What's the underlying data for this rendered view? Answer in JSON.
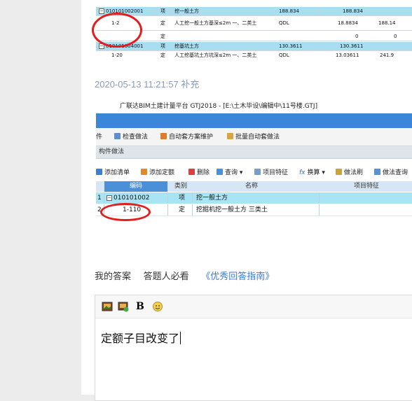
{
  "top_table": {
    "rows": [
      {
        "code": "010101002001",
        "type": "项",
        "name": "挖一般土方",
        "unit": "188.834",
        "qty": "188.834",
        "price": "",
        "highlight": true
      },
      {
        "code": "1-2",
        "type": "定",
        "name": "人工挖一般土方基深≤2m 一、二类土",
        "unit": "QDL",
        "qty": "18.8834",
        "price": "188.14",
        "highlight": false
      },
      {
        "code": "",
        "type": "定",
        "name": "",
        "unit": "",
        "qty": "0",
        "price": "0",
        "highlight": false
      },
      {
        "code": "010101004001",
        "type": "项",
        "name": "挖基坑土方",
        "unit": "130.3611",
        "qty": "130.3611",
        "price": "",
        "highlight": true
      },
      {
        "code": "1-20",
        "type": "定",
        "name": "人工挖基坑土方坑深≤2m 一、二类土",
        "unit": "QDL",
        "qty": "13.03611",
        "price": "241.9",
        "highlight": false
      }
    ]
  },
  "supplement_time": "2020-05-13 11:21:57 补充",
  "software": {
    "title": "广联达BIM土建计量平台 GTJ2018 - [E:\\土木毕设\\编辑中\\11号楼.GTJ]",
    "toolbar1": [
      "件",
      "检查做法",
      "自动套方案维护",
      "批量自动套做法"
    ],
    "panel_title": "构件做法",
    "toolbar2": [
      "添加清单",
      "添加定额",
      "删除",
      "查询",
      "项目特征",
      "换算",
      "做法刷",
      "做法查询"
    ],
    "grid_headers": [
      "编码",
      "类别",
      "名称",
      "项目特征"
    ],
    "grid_rows": [
      {
        "num": "1",
        "code": "010101002",
        "type": "项",
        "name": "挖一般土方",
        "highlight": true
      },
      {
        "num": "2",
        "code": "1-110",
        "type": "定",
        "name": "挖掘机挖一般土方 三类土",
        "highlight": false
      }
    ]
  },
  "answer": {
    "tabs": [
      "我的答案",
      "答题人必看",
      "《优秀回答指南》"
    ],
    "editor_bold": "B",
    "editor_text": "定额子目改变了"
  },
  "colors": {
    "annotation": "#e61b1b",
    "link": "#3b7bd6",
    "highlight": "#a9def0",
    "titlebar_blue": "#3a86d8"
  }
}
